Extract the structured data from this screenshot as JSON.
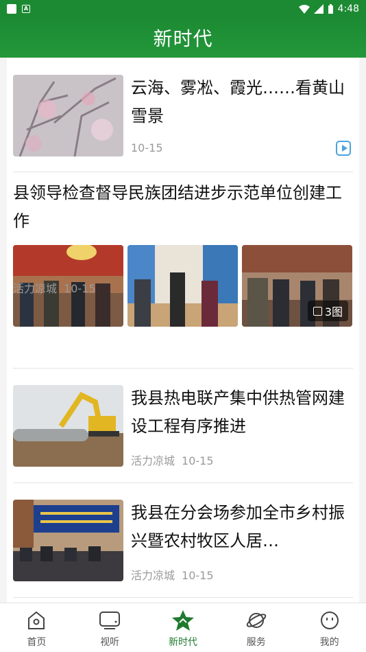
{
  "status_bar": {
    "time": "4:48"
  },
  "header": {
    "title": "新时代"
  },
  "articles": [
    {
      "title": "云海、雾凇、霞光……看黄山雪景",
      "date": "10-15"
    },
    {
      "title": "县领导检查督导民族团结进步示范单位创建工作",
      "source": "活力凉城",
      "date": "10-15",
      "image_count": "3图"
    },
    {
      "title": "我县热电联产集中供热管网建设工程有序推进",
      "source": "活力凉城",
      "date": "10-15"
    },
    {
      "title": "我县在分会场参加全市乡村振兴暨农村牧区人居…",
      "source": "活力凉城",
      "date": "10-15"
    }
  ],
  "tabs": [
    {
      "label": "首页",
      "icon": "home-icon"
    },
    {
      "label": "视听",
      "icon": "tv-icon"
    },
    {
      "label": "新时代",
      "icon": "star-icon"
    },
    {
      "label": "服务",
      "icon": "planet-icon"
    },
    {
      "label": "我的",
      "icon": "smiley-icon"
    }
  ],
  "colors": {
    "brand_green": "#1c8a33",
    "active_tab": "#1f7a2e",
    "play_blue": "#4aa3df"
  }
}
